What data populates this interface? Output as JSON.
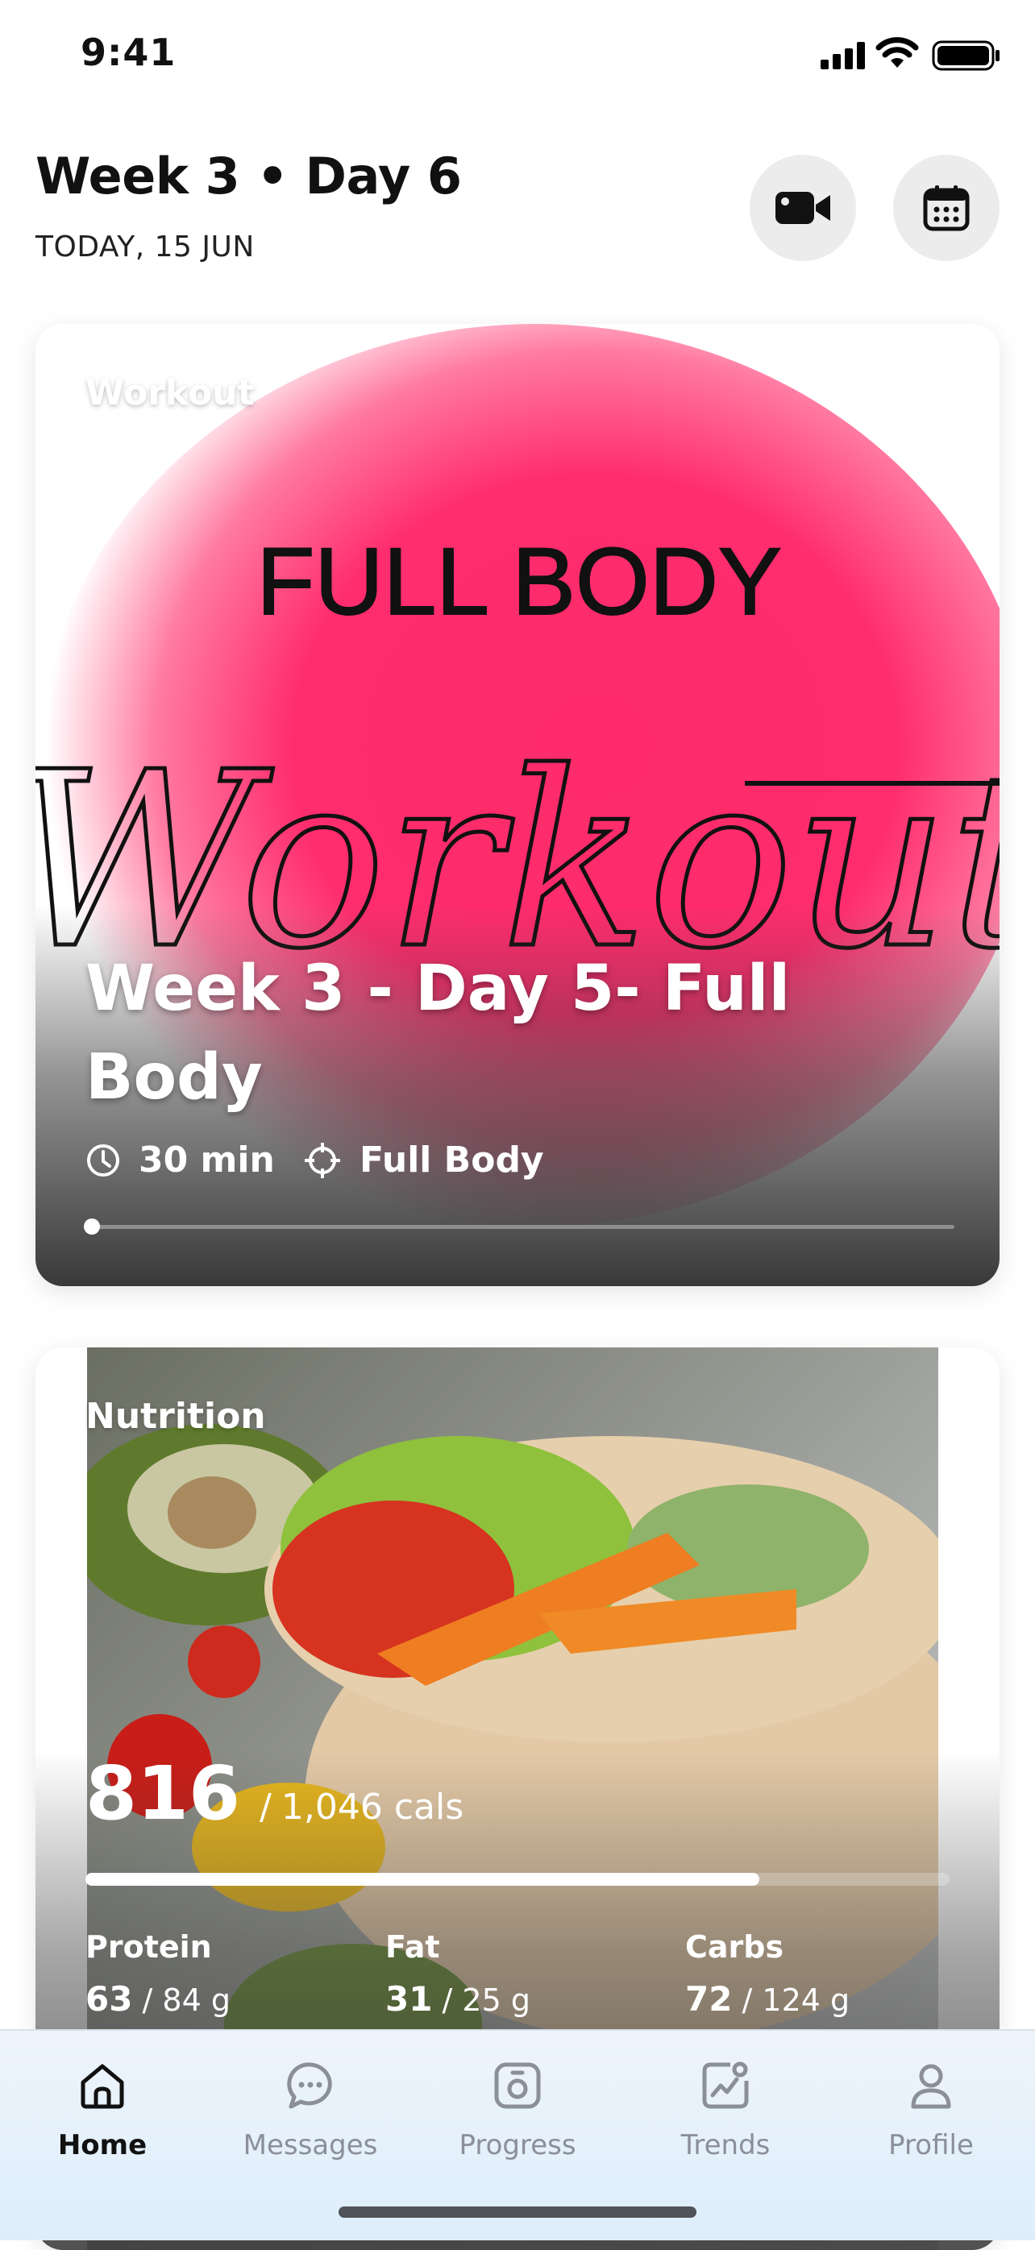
{
  "status_bar": {
    "time": "9:41"
  },
  "header": {
    "title": "Week 3 • Day 6",
    "subtitle": "TODAY, 15 JUN",
    "buttons": [
      {
        "icon": "video-camera-icon"
      },
      {
        "icon": "calendar-icon"
      }
    ]
  },
  "workout_card": {
    "label": "Workout",
    "artwork_text": [
      "FULL BODY",
      "Workout"
    ],
    "title": "Week 3 - Day 5- Full Body",
    "duration": "30 min",
    "focus": "Full Body",
    "progress": 0,
    "colors": {
      "glow": "#ff2d6e"
    }
  },
  "nutrition_card": {
    "label": "Nutrition",
    "calories_consumed": "816",
    "calories_separator": "/",
    "calories_goal": "1,046 cals",
    "calorie_progress": 0.78,
    "macros": [
      {
        "name": "Protein",
        "value": "63",
        "goal": "/ 84 g"
      },
      {
        "name": "Fat",
        "value": "31",
        "goal": "/ 25 g"
      },
      {
        "name": "Carbs",
        "value": "72",
        "goal": "/ 124 g"
      }
    ]
  },
  "tab_bar": {
    "tabs": [
      {
        "label": "Home",
        "icon": "home-icon",
        "active": true
      },
      {
        "label": "Messages",
        "icon": "chat-bubble-icon",
        "active": false
      },
      {
        "label": "Progress",
        "icon": "progress-photo-icon",
        "active": false
      },
      {
        "label": "Trends",
        "icon": "trends-chart-icon",
        "active": false
      },
      {
        "label": "Profile",
        "icon": "person-icon",
        "active": false
      }
    ]
  }
}
